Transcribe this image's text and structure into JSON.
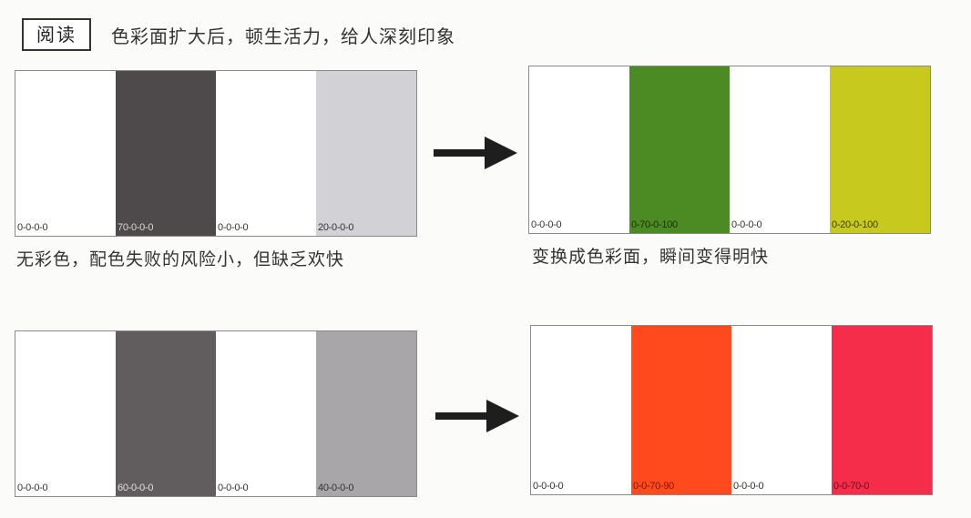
{
  "header": {
    "tag": "阅读",
    "headline": "色彩面扩大后，顿生活力，给人深刻印象"
  },
  "rows": [
    {
      "before": {
        "caption": "无彩色，配色失败的风险小，但缺乏欢快",
        "swatches": [
          {
            "code": "0-0-0-0",
            "color": "#ffffff",
            "text_color": "#333333"
          },
          {
            "code": "70-0-0-0",
            "color": "#4e4a4b",
            "text_color": "#d8d6d6"
          },
          {
            "code": "0-0-0-0",
            "color": "#ffffff",
            "text_color": "#333333"
          },
          {
            "code": "20-0-0-0",
            "color": "#d2d1d5",
            "text_color": "#333333"
          }
        ]
      },
      "after": {
        "caption": "变换成色彩面，瞬间变得明快",
        "swatches": [
          {
            "code": "0-0-0-0",
            "color": "#ffffff",
            "text_color": "#333333"
          },
          {
            "code": "0-70-0-100",
            "color": "#4c8a24",
            "text_color": "#1b2d0c"
          },
          {
            "code": "0-0-0-0",
            "color": "#ffffff",
            "text_color": "#333333"
          },
          {
            "code": "0-20-0-100",
            "color": "#c8c91e",
            "text_color": "#3e3d08"
          }
        ]
      }
    },
    {
      "before": {
        "caption": "",
        "swatches": [
          {
            "code": "0-0-0-0",
            "color": "#ffffff",
            "text_color": "#333333"
          },
          {
            "code": "60-0-0-0",
            "color": "#615c5e",
            "text_color": "#e0dddd"
          },
          {
            "code": "0-0-0-0",
            "color": "#ffffff",
            "text_color": "#333333"
          },
          {
            "code": "40-0-0-0",
            "color": "#a8a6a8",
            "text_color": "#333333"
          }
        ]
      },
      "after": {
        "caption": "",
        "swatches": [
          {
            "code": "0-0-0-0",
            "color": "#ffffff",
            "text_color": "#333333"
          },
          {
            "code": "0-0-70-90",
            "color": "#ff4a1e",
            "text_color": "#7a1a08"
          },
          {
            "code": "0-0-0-0",
            "color": "#ffffff",
            "text_color": "#333333"
          },
          {
            "code": "0-0-70-0",
            "color": "#f52c4a",
            "text_color": "#6a0e1c"
          }
        ]
      }
    }
  ],
  "colors": {
    "arrow": "#1e1e1e",
    "border": "#8a8a8a"
  }
}
